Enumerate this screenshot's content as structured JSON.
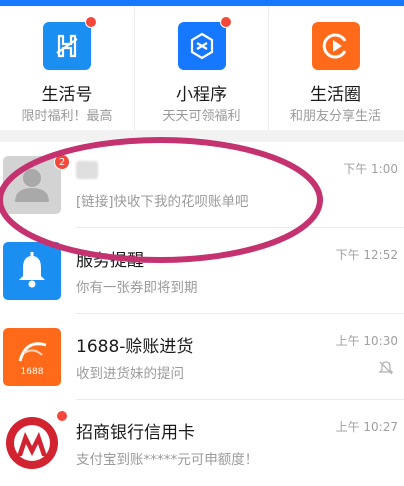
{
  "colors": {
    "accent": "#1677ff",
    "annotation": "#c4326f",
    "badge": "#f5483b"
  },
  "shortcuts": [
    {
      "label": "生活号",
      "sub": "限时福利！最高",
      "icon": "life-account-icon",
      "color": "#1b8ef2",
      "has_dot": true
    },
    {
      "label": "小程序",
      "sub": "天天可领福利",
      "icon": "mini-program-icon",
      "color": "#1677ff",
      "has_dot": true
    },
    {
      "label": "生活圈",
      "sub": "和朋友分享生活",
      "icon": "life-circle-icon",
      "color": "#ff6a1a",
      "has_dot": false
    }
  ],
  "messages": [
    {
      "name": "",
      "preview": "[链接]快收下我的花呗账单吧",
      "time": "下午 1:00",
      "badge": "2",
      "icon": "default-avatar-icon"
    },
    {
      "name": "服务提醒",
      "preview": "你有一张券即将到期",
      "time": "下午 12:52",
      "icon": "bell-icon"
    },
    {
      "name": "1688-赊账进货",
      "preview": "收到进货妹的提问",
      "time": "上午 10:30",
      "icon": "1688-logo-icon",
      "logo_text": "1688",
      "muted": true
    },
    {
      "name": "招商银行信用卡",
      "preview": "支付宝到账*****元可申额度！",
      "time": "上午 10:27",
      "icon": "cmb-logo-icon",
      "has_dot": true
    }
  ]
}
